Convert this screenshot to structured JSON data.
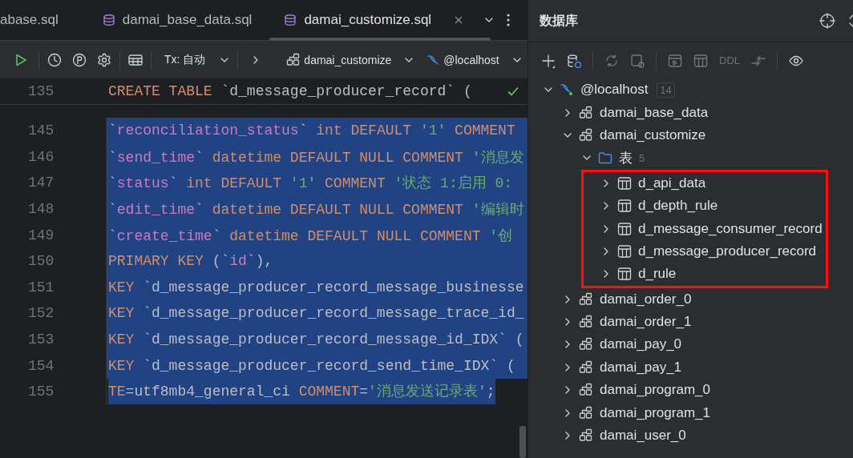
{
  "editor_tabs": [
    {
      "label": "abase.sql",
      "selected": false,
      "icon": false
    },
    {
      "label": "damai_base_data.sql",
      "selected": false,
      "icon": true
    },
    {
      "label": "damai_customize.sql",
      "selected": true,
      "icon": true
    }
  ],
  "toolbar": {
    "transaction": "Tx: 自动",
    "schema": "damai_customize",
    "datasource": "@localhost"
  },
  "editor": {
    "sticky": {
      "number": "135",
      "tokens": [
        {
          "kind": "keyword",
          "t": "CREATE TABLE "
        },
        {
          "kind": "plain",
          "t": "`d_message_producer_record` ("
        }
      ]
    },
    "lines": [
      {
        "number": "145",
        "selected": true,
        "tokens": [
          {
            "kind": "plain",
            "t": "`"
          },
          {
            "kind": "identifier",
            "t": "reconciliation_status"
          },
          {
            "kind": "plain",
            "t": "` "
          },
          {
            "kind": "keyword",
            "t": "int DEFAULT "
          },
          {
            "kind": "string",
            "t": "'1'"
          },
          {
            "kind": "keyword",
            "t": " COMMENT"
          }
        ]
      },
      {
        "number": "146",
        "selected": true,
        "tokens": [
          {
            "kind": "plain",
            "t": "`"
          },
          {
            "kind": "identifier",
            "t": "send_time"
          },
          {
            "kind": "plain",
            "t": "` "
          },
          {
            "kind": "keyword",
            "t": "datetime DEFAULT NULL COMMENT "
          },
          {
            "kind": "string",
            "t": "'消息发"
          }
        ]
      },
      {
        "number": "147",
        "selected": true,
        "tokens": [
          {
            "kind": "plain",
            "t": "`"
          },
          {
            "kind": "identifier",
            "t": "status"
          },
          {
            "kind": "plain",
            "t": "` "
          },
          {
            "kind": "keyword",
            "t": "int DEFAULT "
          },
          {
            "kind": "string",
            "t": "'1'"
          },
          {
            "kind": "keyword",
            "t": " COMMENT "
          },
          {
            "kind": "string",
            "t": "'状态 1:启用 0:"
          }
        ]
      },
      {
        "number": "148",
        "selected": true,
        "tokens": [
          {
            "kind": "plain",
            "t": "`"
          },
          {
            "kind": "identifier",
            "t": "edit_time"
          },
          {
            "kind": "plain",
            "t": "` "
          },
          {
            "kind": "keyword",
            "t": "datetime DEFAULT NULL COMMENT "
          },
          {
            "kind": "string",
            "t": "'编辑时"
          }
        ]
      },
      {
        "number": "149",
        "selected": true,
        "tokens": [
          {
            "kind": "plain",
            "t": "`"
          },
          {
            "kind": "identifier",
            "t": "create_time"
          },
          {
            "kind": "plain",
            "t": "` "
          },
          {
            "kind": "keyword",
            "t": "datetime DEFAULT NULL COMMENT "
          },
          {
            "kind": "string",
            "t": "'创"
          }
        ]
      },
      {
        "number": "150",
        "selected": true,
        "tokens": [
          {
            "kind": "keyword",
            "t": "PRIMARY KEY "
          },
          {
            "kind": "plain",
            "t": "(`"
          },
          {
            "kind": "identifier",
            "t": "id"
          },
          {
            "kind": "plain",
            "t": "`),"
          }
        ]
      },
      {
        "number": "151",
        "selected": true,
        "tokens": [
          {
            "kind": "keyword",
            "t": "KEY "
          },
          {
            "kind": "plain",
            "t": "`d_message_producer_record_message_businesse"
          }
        ]
      },
      {
        "number": "152",
        "selected": true,
        "tokens": [
          {
            "kind": "keyword",
            "t": "KEY "
          },
          {
            "kind": "plain",
            "t": "`d_message_producer_record_message_trace_id_"
          }
        ]
      },
      {
        "number": "153",
        "selected": true,
        "tokens": [
          {
            "kind": "keyword",
            "t": "KEY "
          },
          {
            "kind": "plain",
            "t": "`d_message_producer_record_message_id_IDX` ("
          }
        ]
      },
      {
        "number": "154",
        "selected": true,
        "tokens": [
          {
            "kind": "keyword",
            "t": "KEY "
          },
          {
            "kind": "plain",
            "t": "`d_message_producer_record_send_time_IDX` ("
          }
        ]
      },
      {
        "number": "155",
        "selected": true,
        "tokens": [
          {
            "kind": "keyword",
            "t": "TE"
          },
          {
            "kind": "plain",
            "t": "=utf8mb4_general_ci "
          },
          {
            "kind": "keyword",
            "t": "COMMENT"
          },
          {
            "kind": "plain",
            "t": "="
          },
          {
            "kind": "string",
            "t": "'消息发送记录表'"
          },
          {
            "kind": "plain",
            "t": ";"
          }
        ]
      }
    ]
  },
  "database": {
    "title": "数据库",
    "toolbar": [
      {
        "kind": "add",
        "disabled": false
      },
      {
        "kind": "db-settings",
        "disabled": false
      },
      {
        "kind": "refresh",
        "disabled": true
      },
      {
        "kind": "plug",
        "disabled": true
      },
      {
        "kind": "console",
        "disabled": true
      },
      {
        "kind": "table",
        "disabled": true
      },
      {
        "kind": "text",
        "label": "DDL",
        "disabled": true
      },
      {
        "kind": "compare",
        "disabled": true
      },
      {
        "kind": "eye",
        "disabled": false
      }
    ],
    "tree": [
      {
        "kind": "datasource",
        "label": "@localhost",
        "count": "14",
        "expanded": true,
        "children": [
          {
            "kind": "schema",
            "label": "damai_base_data",
            "expanded": false
          },
          {
            "kind": "schema",
            "label": "damai_customize",
            "expanded": true,
            "children": [
              {
                "kind": "folder",
                "label": "表",
                "count": "5",
                "expanded": true,
                "highlighted": true,
                "children": [
                  {
                    "kind": "table",
                    "label": "d_api_data",
                    "expanded": false
                  },
                  {
                    "kind": "table",
                    "label": "d_depth_rule",
                    "expanded": false
                  },
                  {
                    "kind": "table",
                    "label": "d_message_consumer_record",
                    "expanded": false
                  },
                  {
                    "kind": "table",
                    "label": "d_message_producer_record",
                    "expanded": false
                  },
                  {
                    "kind": "table",
                    "label": "d_rule",
                    "expanded": false
                  }
                ]
              }
            ]
          },
          {
            "kind": "schema",
            "label": "damai_order_0",
            "expanded": false
          },
          {
            "kind": "schema",
            "label": "damai_order_1",
            "expanded": false
          },
          {
            "kind": "schema",
            "label": "damai_pay_0",
            "expanded": false
          },
          {
            "kind": "schema",
            "label": "damai_pay_1",
            "expanded": false
          },
          {
            "kind": "schema",
            "label": "damai_program_0",
            "expanded": false
          },
          {
            "kind": "schema",
            "label": "damai_program_1",
            "expanded": false
          },
          {
            "kind": "schema",
            "label": "damai_user_0",
            "expanded": false
          }
        ]
      }
    ]
  }
}
